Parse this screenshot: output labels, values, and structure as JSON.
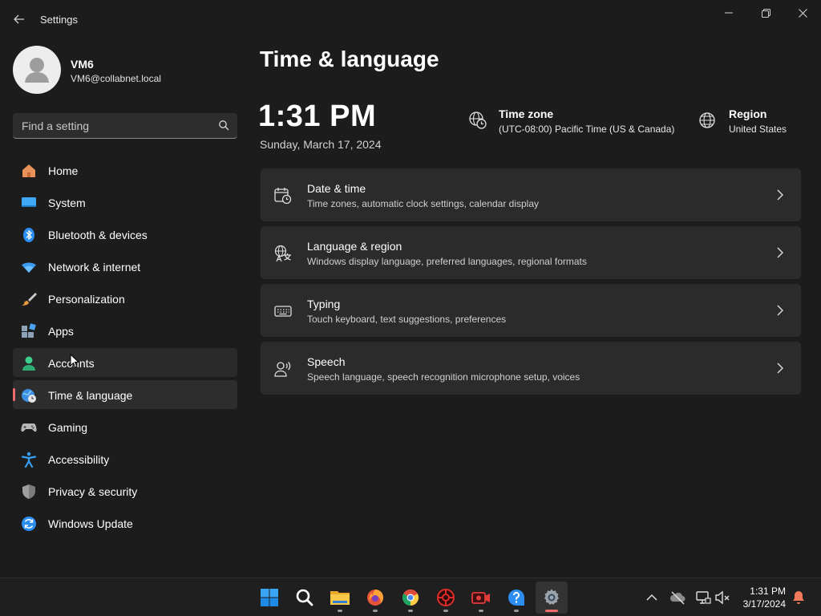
{
  "window": {
    "title": "Settings"
  },
  "profile": {
    "name": "VM6",
    "email": "VM6@collabnet.local"
  },
  "search": {
    "placeholder": "Find a setting"
  },
  "sidebar": {
    "items": [
      {
        "label": "Home",
        "icon": "home-icon"
      },
      {
        "label": "System",
        "icon": "system-icon"
      },
      {
        "label": "Bluetooth & devices",
        "icon": "bluetooth-icon"
      },
      {
        "label": "Network & internet",
        "icon": "wifi-icon"
      },
      {
        "label": "Personalization",
        "icon": "brush-icon"
      },
      {
        "label": "Apps",
        "icon": "apps-icon"
      },
      {
        "label": "Accounts",
        "icon": "accounts-icon"
      },
      {
        "label": "Time & language",
        "icon": "time-language-icon"
      },
      {
        "label": "Gaming",
        "icon": "gamepad-icon"
      },
      {
        "label": "Accessibility",
        "icon": "accessibility-icon"
      },
      {
        "label": "Privacy & security",
        "icon": "shield-icon"
      },
      {
        "label": "Windows Update",
        "icon": "update-icon"
      }
    ],
    "selected": "Time & language",
    "hovered": "Accounts"
  },
  "main": {
    "title": "Time & language",
    "time": "1:31 PM",
    "date": "Sunday, March 17, 2024",
    "timezone": {
      "title": "Time zone",
      "value": "(UTC-08:00) Pacific Time (US & Canada)"
    },
    "region": {
      "title": "Region",
      "value": "United States"
    },
    "cards": [
      {
        "title": "Date & time",
        "desc": "Time zones, automatic clock settings, calendar display",
        "icon": "calendar-clock-icon"
      },
      {
        "title": "Language & region",
        "desc": "Windows display language, preferred languages, regional formats",
        "icon": "language-icon"
      },
      {
        "title": "Typing",
        "desc": "Touch keyboard, text suggestions, preferences",
        "icon": "keyboard-icon"
      },
      {
        "title": "Speech",
        "desc": "Speech language, speech recognition microphone setup, voices",
        "icon": "speech-icon"
      }
    ]
  },
  "taskbar": {
    "apps": [
      "start-icon",
      "search-icon",
      "file-explorer-icon",
      "firefox-icon",
      "chrome-icon",
      "security-app-icon",
      "recorder-icon",
      "help-icon",
      "settings-icon"
    ],
    "clock_time": "1:31 PM",
    "clock_date": "3/17/2024"
  },
  "colors": {
    "accent": "#f16b6b",
    "background": "#1c1c1c",
    "card": "#2b2b2b"
  }
}
